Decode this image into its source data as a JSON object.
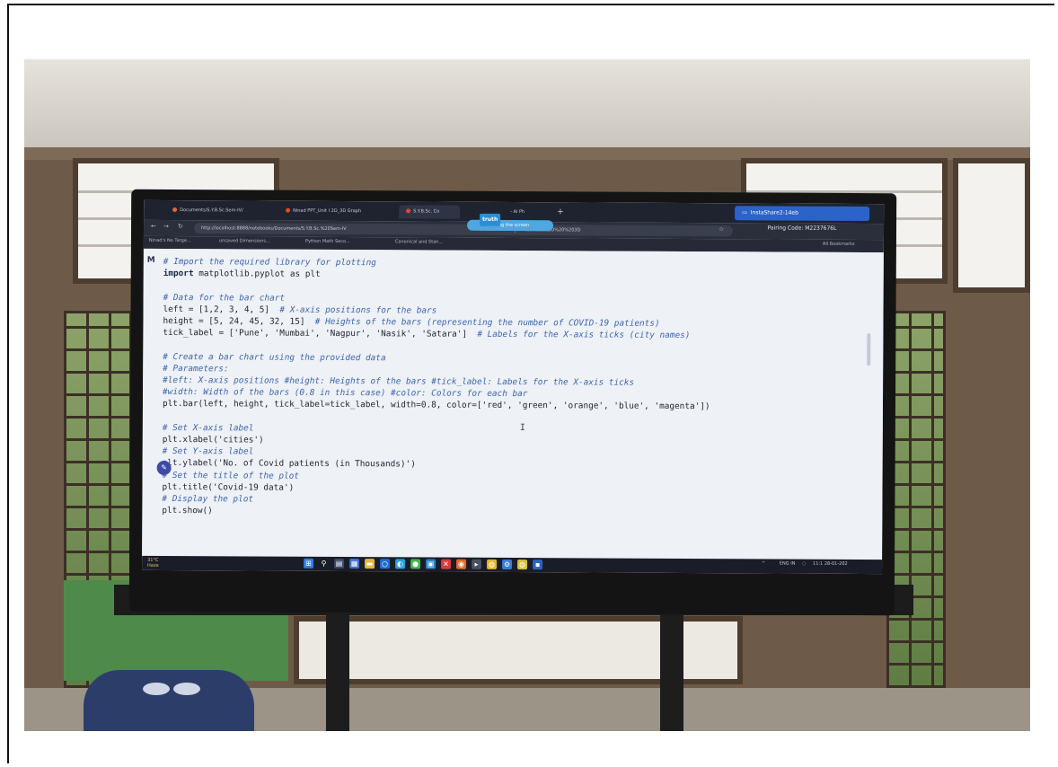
{
  "browser": {
    "tabs": [
      {
        "label": "Documents/S.Y.B.Sc.Sem-IV/"
      },
      {
        "label": "Ninad PPT_Unit I 2D_3D Graph"
      },
      {
        "label": "S.Y.B.Sc. Co"
      },
      {
        "label": "- AI Ph"
      }
    ],
    "new_tab_symbol": "+",
    "sharing_popup": {
      "label": "InstaShare2-14eb"
    },
    "url": "http://localhost:8888/notebooks/Documents/S.Y.B.Sc.%20Sem-IV",
    "url_tail": "/Ninad%20PPT_Unit%201%202D%20%203D",
    "sharing_pill": {
      "tag": "truth",
      "label": "Sharing the screen"
    },
    "pairing_code": "Pairing Code: M2237676L",
    "bookmarks": [
      "Ninad's No Targe...",
      "unsaved Dimensions...",
      "Python Math Seco...",
      "Canonical and Stan..."
    ],
    "all_bookmarks": "All Bookmarks"
  },
  "notebook": {
    "run_marker": "M",
    "code_lines": [
      {
        "t": "cmt",
        "text": "# Import the required library for plotting"
      },
      {
        "t": "import",
        "kw": "import",
        "rest": " matplotlib.pyplot as plt"
      },
      {
        "t": "blank",
        "text": ""
      },
      {
        "t": "cmt",
        "text": "# Data for the bar chart"
      },
      {
        "t": "code",
        "text": "left = [1,2, 3, 4, 5]",
        "cmt": "  # X-axis positions for the bars"
      },
      {
        "t": "code",
        "text": "height = [5, 24, 45, 32, 15]",
        "cmt": "  # Heights of the bars (representing the number of COVID-19 patients)"
      },
      {
        "t": "code",
        "text": "tick_label = ['Pune', 'Mumbai', 'Nagpur', 'Nasik', 'Satara']",
        "cmt": "  # Labels for the X-axis ticks (city names)"
      },
      {
        "t": "blank",
        "text": ""
      },
      {
        "t": "cmt",
        "text": "# Create a bar chart using the provided data"
      },
      {
        "t": "cmt",
        "text": "# Parameters:"
      },
      {
        "t": "cmt",
        "text": "#left: X-axis positions #height: Heights of the bars #tick_label: Labels for the X-axis ticks"
      },
      {
        "t": "cmt",
        "text": "#width: Width of the bars (0.8 in this case) #color: Colors for each bar"
      },
      {
        "t": "code",
        "text": "plt.bar(left, height, tick_label=tick_label, width=0.8, color=['red', 'green', 'orange', 'blue', 'magenta'])",
        "cmt": ""
      },
      {
        "t": "blank",
        "text": ""
      },
      {
        "t": "cmt",
        "text": "# Set X-axis label"
      },
      {
        "t": "code",
        "text": "plt.xlabel('cities')",
        "cmt": ""
      },
      {
        "t": "cmt",
        "text": "# Set Y-axis label"
      },
      {
        "t": "code",
        "text": "plt.ylabel('No. of Covid patients (in Thousands)')",
        "cmt": ""
      },
      {
        "t": "cmt",
        "text": "# Set the title of the plot"
      },
      {
        "t": "code",
        "text": "plt.title('Covid-19 data')",
        "cmt": ""
      },
      {
        "t": "cmt",
        "text": "# Display the plot"
      },
      {
        "t": "code",
        "text": "plt.show()",
        "cmt": ""
      }
    ],
    "text_cursor": "I"
  },
  "taskbar": {
    "weather_temp": "31°C",
    "weather_desc": "Haze",
    "tray_lang": "ENG",
    "tray_region": "IN",
    "clock_time": "11:1",
    "clock_date": "28-01-202"
  },
  "colors": {
    "code_comment": "#3c66b0",
    "code_string": "#b33a6a",
    "popup_blue": "#2b63c9"
  }
}
